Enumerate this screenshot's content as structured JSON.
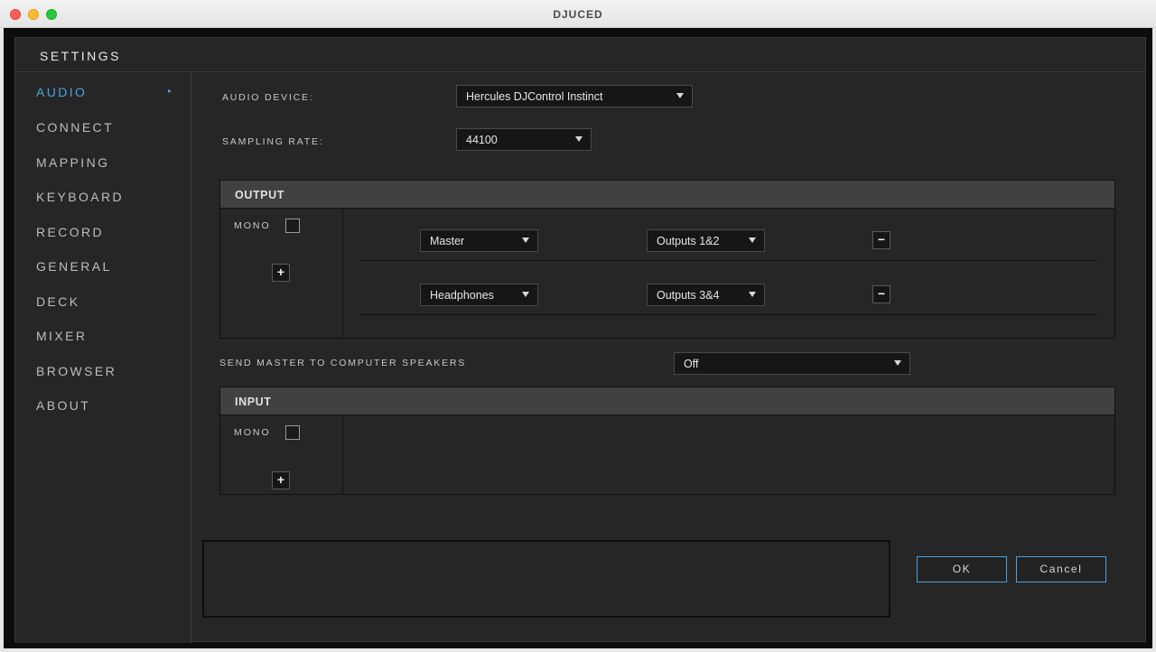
{
  "window": {
    "title": "DJUCED"
  },
  "header": {
    "title": "SETTINGS"
  },
  "sidebar": {
    "items": [
      {
        "label": "AUDIO",
        "active": true
      },
      {
        "label": "CONNECT"
      },
      {
        "label": "MAPPING"
      },
      {
        "label": "KEYBOARD"
      },
      {
        "label": "RECORD"
      },
      {
        "label": "GENERAL"
      },
      {
        "label": "DECK"
      },
      {
        "label": "MIXER"
      },
      {
        "label": "BROWSER"
      },
      {
        "label": "ABOUT"
      }
    ],
    "active_arrow": "▸"
  },
  "audio": {
    "device_label": "AUDIO DEVICE:",
    "device_value": "Hercules DJControl Instinct",
    "sampling_label": "SAMPLING RATE:",
    "sampling_value": "44100",
    "output": {
      "title": "OUTPUT",
      "mono_label": "MONO",
      "mono_checked": false,
      "add_label": "+",
      "rows": [
        {
          "channel": "Master",
          "outputs": "Outputs 1&2",
          "remove_label": "−"
        },
        {
          "channel": "Headphones",
          "outputs": "Outputs 3&4",
          "remove_label": "−"
        }
      ]
    },
    "send_master_label": "SEND MASTER TO COMPUTER SPEAKERS",
    "send_master_value": "Off",
    "input": {
      "title": "INPUT",
      "mono_label": "MONO",
      "mono_checked": false,
      "add_label": "+"
    }
  },
  "footer": {
    "ok_label": "OK",
    "cancel_label": "Cancel"
  },
  "colors": {
    "accent": "#4aa3df",
    "panel": "#262626",
    "section_header": "#414141"
  }
}
